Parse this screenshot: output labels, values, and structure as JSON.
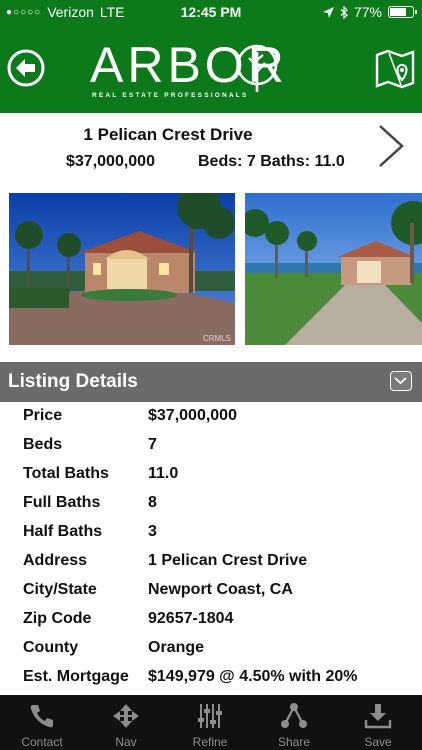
{
  "status_bar": {
    "carrier": "Verizon",
    "network": "LTE",
    "time": "12:45 PM",
    "battery": "77%",
    "battery_level": 0.77,
    "signal_bars": 1
  },
  "header": {
    "logo_word": "ARBOR",
    "logo_tagline": "REAL ESTATE PROFESSIONALS",
    "back_icon": "back-arrow-icon",
    "map_icon": "map-pin-icon",
    "brand_color": "#0c7a1a"
  },
  "listing": {
    "address": "1 Pelican Crest Drive",
    "price": "$37,000,000",
    "beds_baths": "Beds: 7  Baths: 11.0",
    "next_icon": "chevron-right-icon"
  },
  "photos": {
    "watermark": "CRMLS"
  },
  "details": {
    "title": "Listing Details",
    "collapse_icon": "chevron-down-icon",
    "rows": [
      {
        "label": "Price",
        "value": "$37,000,000"
      },
      {
        "label": "Beds",
        "value": "7"
      },
      {
        "label": "Total Baths",
        "value": "11.0"
      },
      {
        "label": "Full Baths",
        "value": "8"
      },
      {
        "label": "Half Baths",
        "value": "3"
      },
      {
        "label": "Address",
        "value": "1 Pelican Crest Drive"
      },
      {
        "label": "City/State",
        "value": "Newport Coast, CA"
      },
      {
        "label": "Zip Code",
        "value": "92657-1804"
      },
      {
        "label": "County",
        "value": "Orange"
      },
      {
        "label": "Est. Mortgage",
        "value": "$149,979 @ 4.50% with 20%"
      }
    ]
  },
  "tabbar": {
    "items": [
      {
        "label": "Contact",
        "icon": "phone-icon"
      },
      {
        "label": "Nav",
        "icon": "navigation-icon"
      },
      {
        "label": "Refine",
        "icon": "sliders-icon"
      },
      {
        "label": "Share",
        "icon": "share-icon"
      },
      {
        "label": "Save",
        "icon": "download-icon"
      }
    ]
  }
}
